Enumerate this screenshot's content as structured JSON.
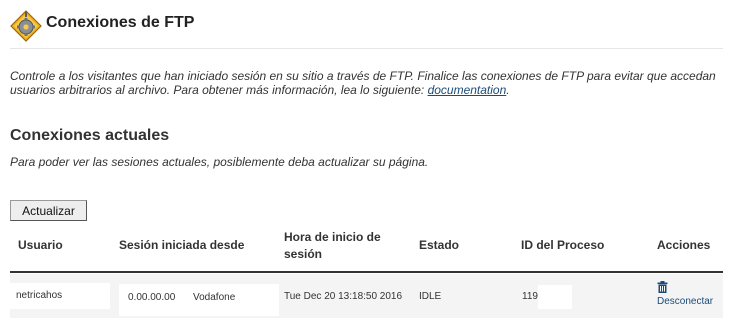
{
  "header": {
    "icon": "ftp-gear-warning-icon",
    "title": "Conexiones de FTP"
  },
  "description": {
    "text_before_link": "Controle a los visitantes que han iniciado sesión en su sitio a través de FTP. Finalice las conexiones de FTP para evitar que accedan usuarios arbitrarios al archivo. Para obtener más información, lea lo siguiente:",
    "link_text": "documentation",
    "text_after_link": "."
  },
  "current_connections": {
    "title": "Conexiones actuales",
    "note": "Para poder ver las sesiones actuales, posiblemente deba actualizar su página.",
    "refresh_label": "Actualizar"
  },
  "table": {
    "columns": [
      "Usuario",
      "Sesión iniciada desde",
      "Hora de inicio de sesión",
      "Estado",
      "ID del Proceso",
      "Acciones"
    ],
    "rows": [
      {
        "user": "netricahos",
        "ip": "0.00.00.00",
        "provider": "Vodafone",
        "login_time": "Tue Dec 20 13:18:50 2016",
        "status": "IDLE",
        "pid": "119",
        "action_icon": "trash-icon",
        "action_label": "Desconectar"
      }
    ]
  }
}
